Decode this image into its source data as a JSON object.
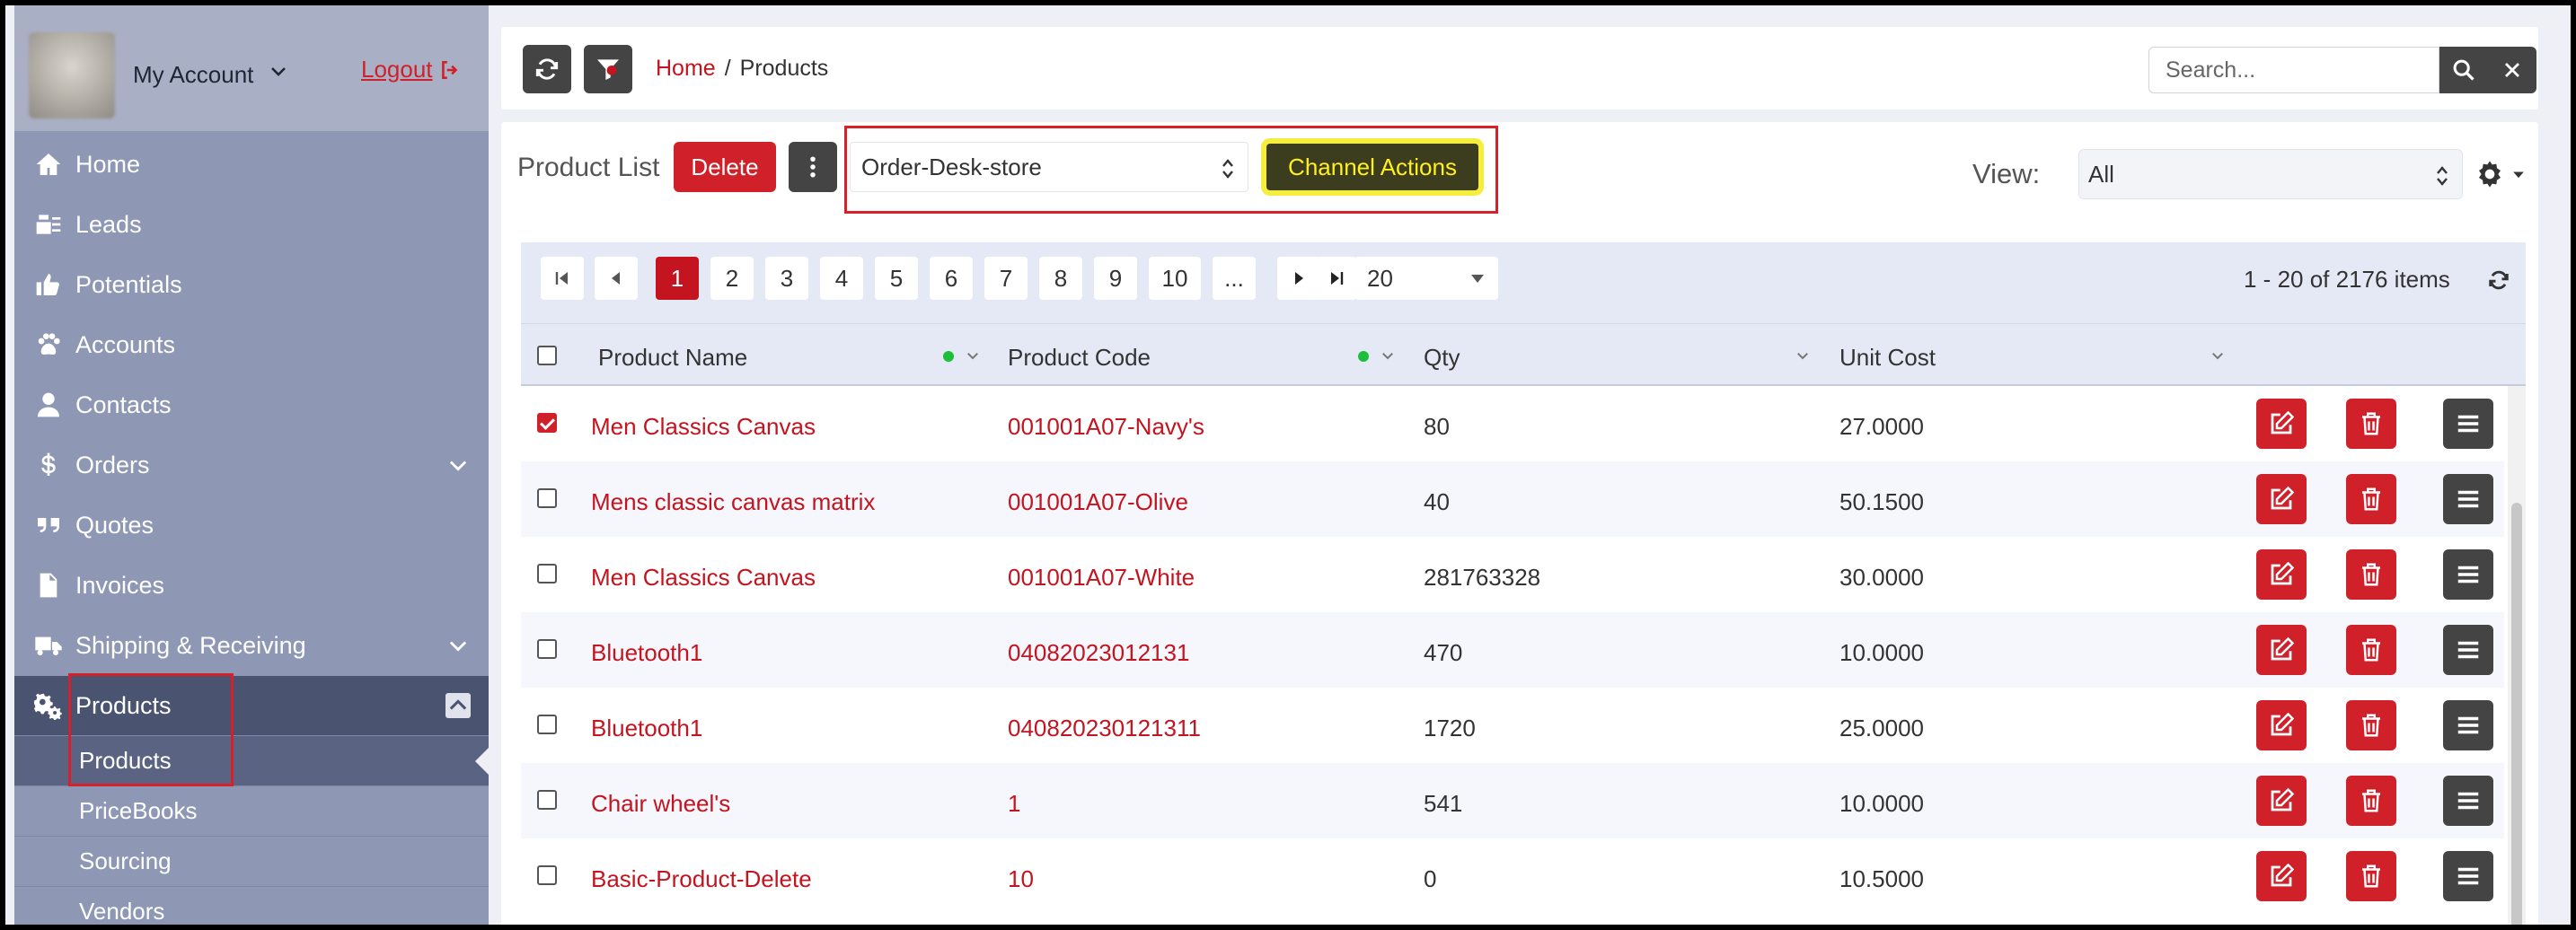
{
  "account": {
    "name": "My Account",
    "logout": "Logout"
  },
  "nav": {
    "items": [
      {
        "label": "Home"
      },
      {
        "label": "Leads"
      },
      {
        "label": "Potentials"
      },
      {
        "label": "Accounts"
      },
      {
        "label": "Contacts"
      },
      {
        "label": "Orders"
      },
      {
        "label": "Quotes"
      },
      {
        "label": "Invoices"
      },
      {
        "label": "Shipping & Receiving"
      },
      {
        "label": "Products"
      }
    ],
    "sub_items": [
      {
        "label": "Products"
      },
      {
        "label": "PriceBooks"
      },
      {
        "label": "Sourcing"
      },
      {
        "label": "Vendors"
      }
    ]
  },
  "breadcrumb": {
    "home": "Home",
    "separator": "/",
    "current": "Products"
  },
  "search": {
    "placeholder": "Search..."
  },
  "toolbar": {
    "title": "Product List",
    "delete_label": "Delete",
    "store_value": "Order-Desk-store",
    "channel_actions_label": "Channel Actions",
    "view_label": "View:",
    "view_value": "All"
  },
  "pager": {
    "pages": [
      "1",
      "2",
      "3",
      "4",
      "5",
      "6",
      "7",
      "8",
      "9",
      "10",
      "..."
    ],
    "active_page": "1",
    "page_size": "20",
    "info": "1 - 20 of 2176 items"
  },
  "table": {
    "columns": [
      "Product Name",
      "Product Code",
      "Qty",
      "Unit Cost"
    ],
    "rows": [
      {
        "name": "Men Classics Canvas",
        "code": "001001A07-Navy's",
        "qty": "80",
        "cost": "27.0000",
        "checked": true
      },
      {
        "name": "Mens classic canvas matrix",
        "code": "001001A07-Olive",
        "qty": "40",
        "cost": "50.1500",
        "checked": false
      },
      {
        "name": "Men Classics Canvas",
        "code": "001001A07-White",
        "qty": "281763328",
        "cost": "30.0000",
        "checked": false
      },
      {
        "name": "Bluetooth1",
        "code": "04082023012131",
        "qty": "470",
        "cost": "10.0000",
        "checked": false
      },
      {
        "name": "Bluetooth1",
        "code": "040820230121311",
        "qty": "1720",
        "cost": "25.0000",
        "checked": false
      },
      {
        "name": "Chair wheel's",
        "code": "1",
        "qty": "541",
        "cost": "10.0000",
        "checked": false
      },
      {
        "name": "Basic-Product-Delete",
        "code": "10",
        "qty": "0",
        "cost": "10.5000",
        "checked": false
      }
    ]
  },
  "colors": {
    "accent_red": "#d0202a",
    "dark_button": "#444444",
    "sidebar": "#8e97b3",
    "highlight_yellow": "#f6ee3c"
  }
}
